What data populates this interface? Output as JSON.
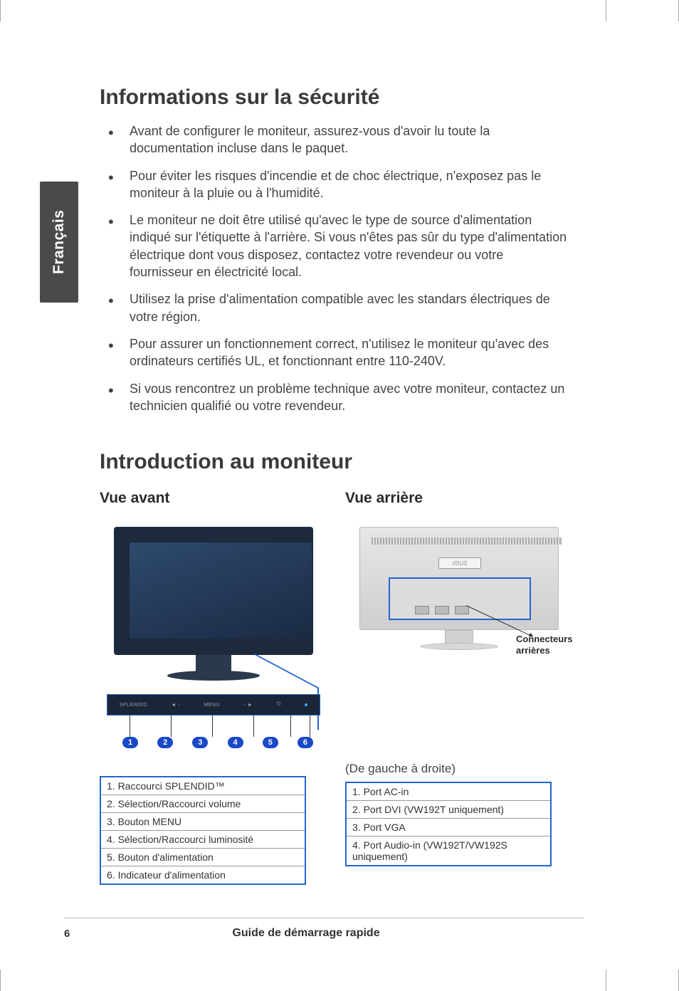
{
  "sideTab": "Français",
  "heading1": "Informations sur la sécurité",
  "bullets": [
    "Avant de configurer le moniteur, assurez-vous d'avoir lu toute la documentation incluse dans le paquet.",
    "Pour éviter les risques d'incendie et de choc électrique, n'exposez pas le moniteur à la pluie ou à l'humidité.",
    "Le moniteur ne doit être utilisé qu'avec le type de source d'alimentation indiqué sur l'étiquette à l'arrière. Si vous n'êtes pas sûr du type d'alimentation électrique dont vous disposez, contactez votre revendeur ou votre fournisseur en électricité local.",
    "Utilisez la prise d'alimentation compatible avec les standars électriques de votre région.",
    "Pour assurer un fonctionnement correct, n'utilisez le moniteur qu'avec des ordinateurs certifiés UL, et fonctionnant entre 110-240V.",
    "Si vous rencontrez un problème technique avec votre moniteur, contactez un technicien qualifié ou votre revendeur."
  ],
  "heading2": "Introduction au moniteur",
  "frontView": {
    "label": "Vue avant",
    "buttonBar": [
      "SPLENDID",
      "◄ -",
      "MENU",
      "- ►",
      "⏻"
    ],
    "markers": [
      "1",
      "2",
      "3",
      "4",
      "5",
      "6"
    ],
    "legend": [
      "1. Raccourci SPLENDID™",
      "2. Sélection/Raccourci volume",
      "3. Bouton MENU",
      "4. Sélection/Raccourci luminosité",
      "5. Bouton d'alimentation",
      "6. Indicateur d'alimentation"
    ]
  },
  "rearView": {
    "label": "Vue arrière",
    "brand": "/ISUS",
    "connectorsLabel": "Connecteurs arrières",
    "legendNote": "(De gauche à droite)",
    "legend": [
      "1. Port AC-in",
      "2. Port DVI (VW192T uniquement)",
      "3. Port VGA",
      "4. Port Audio-in (VW192T/VW192S uniquement)"
    ]
  },
  "pageNumber": "6",
  "footerTitle": "Guide de démarrage rapide"
}
